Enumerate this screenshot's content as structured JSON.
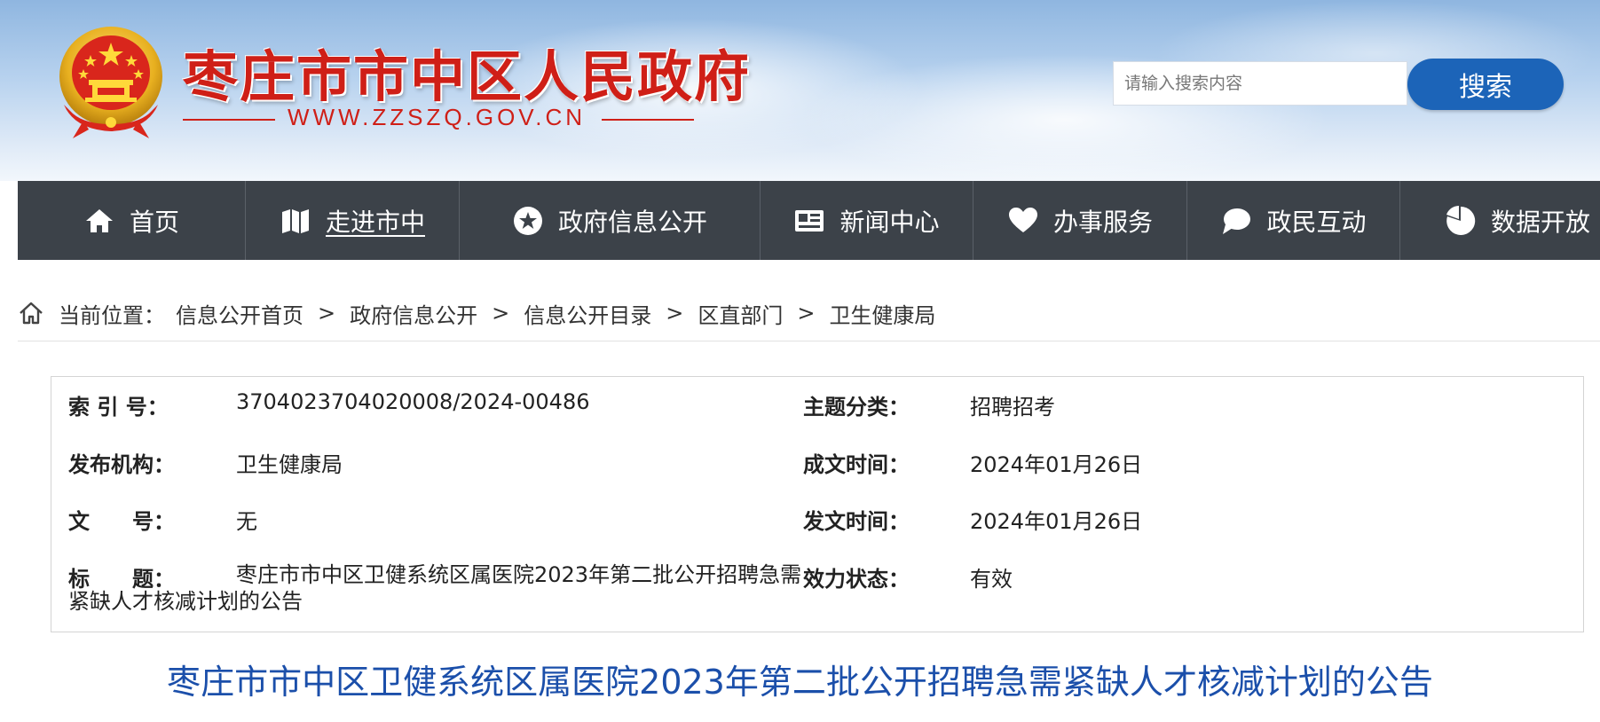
{
  "header": {
    "site_title": "枣庄市市中区人民政府",
    "site_url": "WWW.ZZSZQ.GOV.CN",
    "search_placeholder": "请输入搜索内容",
    "search_button": "搜索",
    "emblem_icon": "national-emblem-icon",
    "brand_red": "#cf1f17",
    "search_blue": "#1c64b8"
  },
  "nav": {
    "background": "#3c4249",
    "items": [
      {
        "label": "首页",
        "icon": "home-icon"
      },
      {
        "label": "走进市中",
        "icon": "map-icon",
        "active": true
      },
      {
        "label": "政府信息公开",
        "icon": "star-badge-icon"
      },
      {
        "label": "新闻中心",
        "icon": "news-card-icon"
      },
      {
        "label": "办事服务",
        "icon": "heart-hand-icon"
      },
      {
        "label": "政民互动",
        "icon": "chat-bubble-icon"
      },
      {
        "label": "数据开放",
        "icon": "pie-chart-icon"
      }
    ]
  },
  "breadcrumb": {
    "prefix": "当前位置：",
    "separator": ">",
    "items": [
      "信息公开首页",
      "政府信息公开",
      "信息公开目录",
      "区直部门",
      "卫生健康局"
    ]
  },
  "info": {
    "index_no_label": "索 引 号：",
    "index_no": "3704023704020008/2024-00486",
    "topic_label": "主题分类：",
    "topic": "招聘招考",
    "publisher_label": "发布机构：",
    "publisher": "卫生健康局",
    "written_date_label": "成文时间：",
    "written_date": "2024年01月26日",
    "doc_no_label": "文　　号：",
    "doc_no": "无",
    "issue_date_label": "发文时间：",
    "issue_date": "2024年01月26日",
    "title_label": "标　　题：",
    "title": "枣庄市市中区卫健系统区属医院2023年第二批公开招聘急需紧缺人才核减计划的公告",
    "status_label": "效力状态：",
    "status": "有效"
  },
  "article": {
    "title": "枣庄市市中区卫健系统区属医院2023年第二批公开招聘急需紧缺人才核减计划的公告",
    "title_color": "#1b4faa"
  }
}
